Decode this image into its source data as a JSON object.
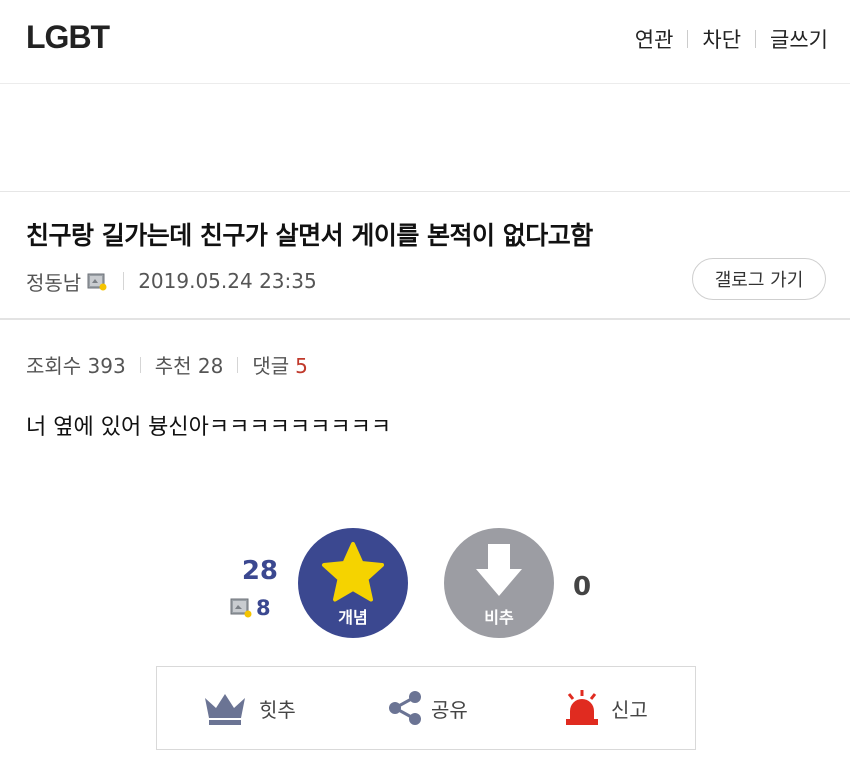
{
  "header": {
    "gallery_name": "LGBT",
    "menu": [
      "연관",
      "차단",
      "글쓰기"
    ]
  },
  "post": {
    "title": "친구랑 길가는데 친구가 살면서 게이를 본적이 없다고함",
    "author": "정동남",
    "datetime": "2019.05.24 23:35",
    "gallery_button": "갤로그 가기",
    "views_label": "조회수 393",
    "recommend_label": "추천 28",
    "comments_label": "댓글",
    "comments_count": "5",
    "body": "너 옆에 있어 븅신아ㅋㅋㅋㅋㅋㅋㅋㅋㅋ"
  },
  "vote": {
    "recommend_count": "28",
    "fixed_recommend_count": "8",
    "recommend_label": "개념",
    "nonrecommend_label": "비추",
    "nonrecommend_count": "0"
  },
  "actions": {
    "hit": "힛추",
    "share": "공유",
    "report": "신고"
  },
  "colors": {
    "accent": "#3b4890",
    "nonrecommend": "#9c9da3",
    "star": "#f5d300",
    "report": "#e02b20",
    "comment_count": "#c0392b"
  }
}
